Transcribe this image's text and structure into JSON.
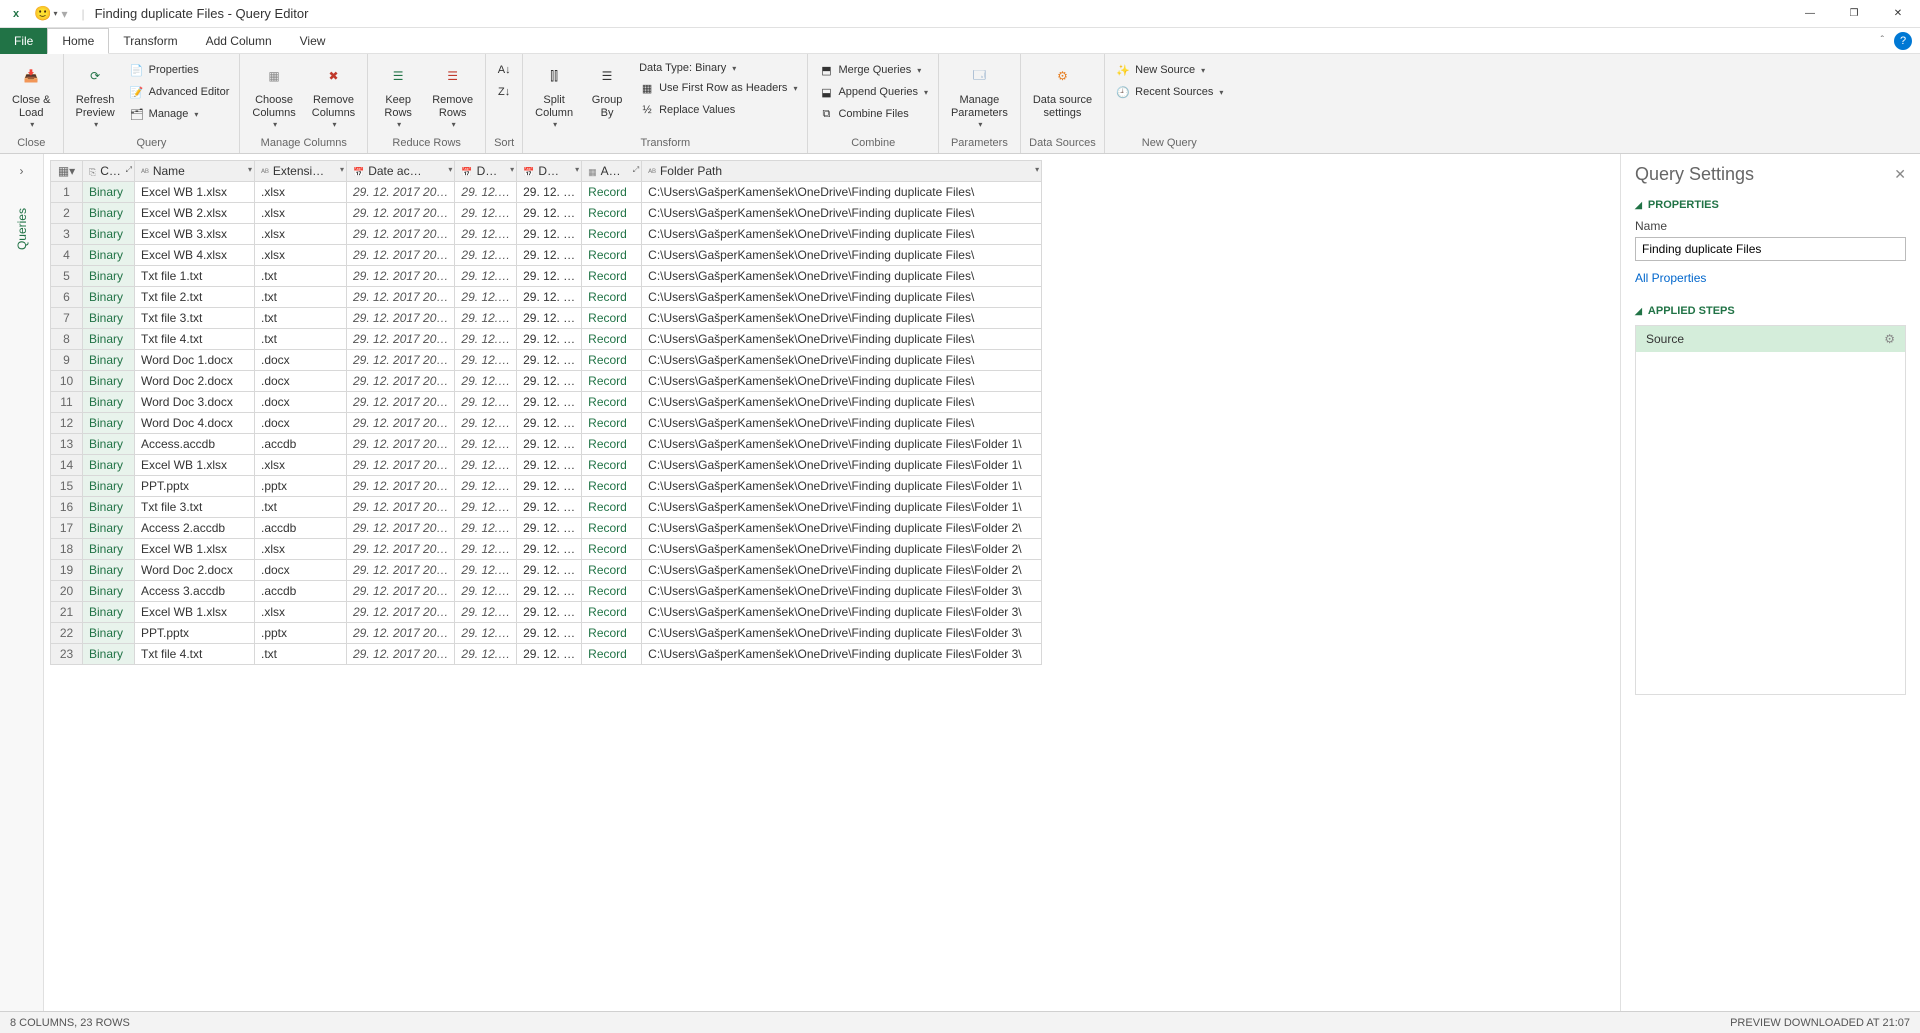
{
  "titlebar": {
    "title": "Finding duplicate Files - Query Editor"
  },
  "tabs": {
    "file": "File",
    "home": "Home",
    "transform": "Transform",
    "addcolumn": "Add Column",
    "view": "View"
  },
  "ribbon": {
    "close": {
      "close_load": "Close &\nLoad",
      "group": "Close"
    },
    "query": {
      "refresh": "Refresh\nPreview",
      "properties": "Properties",
      "advanced": "Advanced Editor",
      "manage": "Manage",
      "group": "Query"
    },
    "manage_cols": {
      "choose": "Choose\nColumns",
      "remove": "Remove\nColumns",
      "group": "Manage Columns"
    },
    "reduce_rows": {
      "keep": "Keep\nRows",
      "remove": "Remove\nRows",
      "group": "Reduce Rows"
    },
    "sort": {
      "group": "Sort"
    },
    "transform": {
      "split": "Split\nColumn",
      "groupby": "Group\nBy",
      "datatype": "Data Type: Binary",
      "firstrow": "Use First Row as Headers",
      "replace": "Replace Values",
      "group": "Transform"
    },
    "combine": {
      "merge": "Merge Queries",
      "append": "Append Queries",
      "combinefiles": "Combine Files",
      "group": "Combine"
    },
    "parameters": {
      "manage": "Manage\nParameters",
      "group": "Parameters"
    },
    "datasources": {
      "settings": "Data source\nsettings",
      "group": "Data Sources"
    },
    "newquery": {
      "newsource": "New Source",
      "recent": "Recent Sources",
      "group": "New Query"
    }
  },
  "leftrail": {
    "label": "Queries"
  },
  "columns": {
    "c": "C…",
    "name": "Name",
    "ext": "Extensi…",
    "date_acc": "Date ac…",
    "d1": "D…",
    "d2": "D…",
    "a": "A…",
    "folder": "Folder Path"
  },
  "rows": [
    {
      "name": "Excel WB 1.xlsx",
      "ext": ".xlsx",
      "path": "C:\\Users\\GašperKamenšek\\OneDrive\\Finding duplicate Files\\"
    },
    {
      "name": "Excel WB 2.xlsx",
      "ext": ".xlsx",
      "path": "C:\\Users\\GašperKamenšek\\OneDrive\\Finding duplicate Files\\"
    },
    {
      "name": "Excel WB 3.xlsx",
      "ext": ".xlsx",
      "path": "C:\\Users\\GašperKamenšek\\OneDrive\\Finding duplicate Files\\"
    },
    {
      "name": "Excel WB 4.xlsx",
      "ext": ".xlsx",
      "path": "C:\\Users\\GašperKamenšek\\OneDrive\\Finding duplicate Files\\"
    },
    {
      "name": "Txt file 1.txt",
      "ext": ".txt",
      "path": "C:\\Users\\GašperKamenšek\\OneDrive\\Finding duplicate Files\\"
    },
    {
      "name": "Txt file 2.txt",
      "ext": ".txt",
      "path": "C:\\Users\\GašperKamenšek\\OneDrive\\Finding duplicate Files\\"
    },
    {
      "name": "Txt file 3.txt",
      "ext": ".txt",
      "path": "C:\\Users\\GašperKamenšek\\OneDrive\\Finding duplicate Files\\"
    },
    {
      "name": "Txt file 4.txt",
      "ext": ".txt",
      "path": "C:\\Users\\GašperKamenšek\\OneDrive\\Finding duplicate Files\\"
    },
    {
      "name": "Word Doc 1.docx",
      "ext": ".docx",
      "path": "C:\\Users\\GašperKamenšek\\OneDrive\\Finding duplicate Files\\"
    },
    {
      "name": "Word Doc 2.docx",
      "ext": ".docx",
      "path": "C:\\Users\\GašperKamenšek\\OneDrive\\Finding duplicate Files\\"
    },
    {
      "name": "Word Doc 3.docx",
      "ext": ".docx",
      "path": "C:\\Users\\GašperKamenšek\\OneDrive\\Finding duplicate Files\\"
    },
    {
      "name": "Word Doc 4.docx",
      "ext": ".docx",
      "path": "C:\\Users\\GašperKamenšek\\OneDrive\\Finding duplicate Files\\"
    },
    {
      "name": "Access.accdb",
      "ext": ".accdb",
      "path": "C:\\Users\\GašperKamenšek\\OneDrive\\Finding duplicate Files\\Folder 1\\"
    },
    {
      "name": "Excel WB 1.xlsx",
      "ext": ".xlsx",
      "path": "C:\\Users\\GašperKamenšek\\OneDrive\\Finding duplicate Files\\Folder 1\\"
    },
    {
      "name": "PPT.pptx",
      "ext": ".pptx",
      "path": "C:\\Users\\GašperKamenšek\\OneDrive\\Finding duplicate Files\\Folder 1\\"
    },
    {
      "name": "Txt file 3.txt",
      "ext": ".txt",
      "path": "C:\\Users\\GašperKamenšek\\OneDrive\\Finding duplicate Files\\Folder 1\\"
    },
    {
      "name": "Access 2.accdb",
      "ext": ".accdb",
      "path": "C:\\Users\\GašperKamenšek\\OneDrive\\Finding duplicate Files\\Folder 2\\"
    },
    {
      "name": "Excel WB 1.xlsx",
      "ext": ".xlsx",
      "path": "C:\\Users\\GašperKamenšek\\OneDrive\\Finding duplicate Files\\Folder 2\\"
    },
    {
      "name": "Word Doc 2.docx",
      "ext": ".docx",
      "path": "C:\\Users\\GašperKamenšek\\OneDrive\\Finding duplicate Files\\Folder 2\\"
    },
    {
      "name": "Access 3.accdb",
      "ext": ".accdb",
      "path": "C:\\Users\\GašperKamenšek\\OneDrive\\Finding duplicate Files\\Folder 3\\"
    },
    {
      "name": "Excel WB 1.xlsx",
      "ext": ".xlsx",
      "path": "C:\\Users\\GašperKamenšek\\OneDrive\\Finding duplicate Files\\Folder 3\\"
    },
    {
      "name": "PPT.pptx",
      "ext": ".pptx",
      "path": "C:\\Users\\GašperKamenšek\\OneDrive\\Finding duplicate Files\\Folder 3\\"
    },
    {
      "name": "Txt file 4.txt",
      "ext": ".txt",
      "path": "C:\\Users\\GašperKamenšek\\OneDrive\\Finding duplicate Files\\Folder 3\\"
    }
  ],
  "cell_common": {
    "binary": "Binary",
    "date_acc": "29. 12. 2017 20…",
    "d1": "29. 12.…",
    "d2": "29. 12. …",
    "record": "Record"
  },
  "settings": {
    "title": "Query Settings",
    "properties": "PROPERTIES",
    "name_label": "Name",
    "name_value": "Finding duplicate Files",
    "all_props": "All Properties",
    "applied_steps": "APPLIED STEPS",
    "step_source": "Source"
  },
  "status": {
    "left": "8 COLUMNS, 23 ROWS",
    "right": "PREVIEW DOWNLOADED AT 21:07"
  }
}
